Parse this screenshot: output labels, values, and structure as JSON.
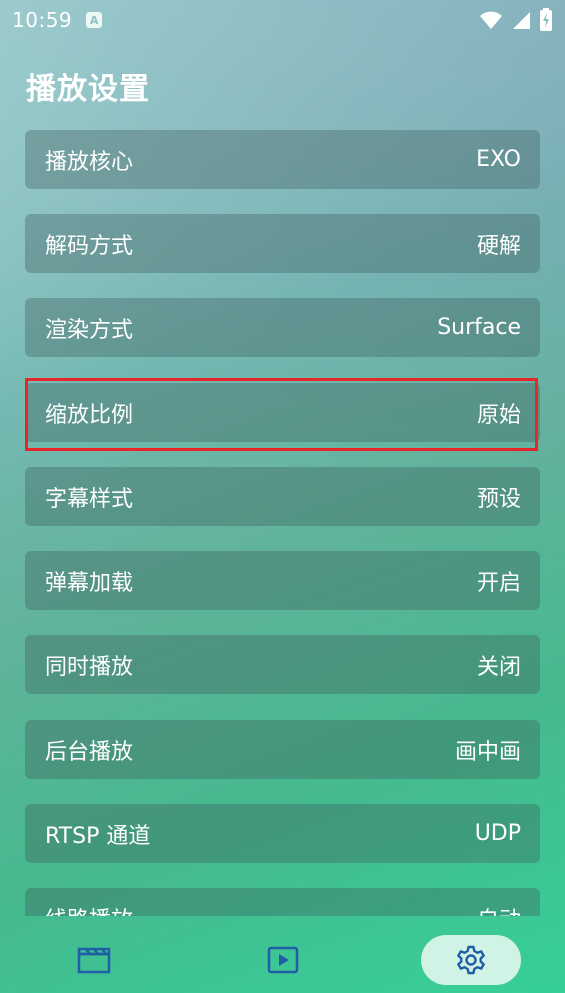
{
  "status_bar": {
    "time": "10:59",
    "notif_glyph": "A"
  },
  "page": {
    "title": "播放设置"
  },
  "settings": [
    {
      "label": "播放核心",
      "value": "EXO"
    },
    {
      "label": "解码方式",
      "value": "硬解"
    },
    {
      "label": "渲染方式",
      "value": "Surface"
    },
    {
      "label": "缩放比例",
      "value": "原始"
    },
    {
      "label": "字幕样式",
      "value": "预设"
    },
    {
      "label": "弹幕加载",
      "value": "开启"
    },
    {
      "label": "同时播放",
      "value": "关闭"
    },
    {
      "label": "后台播放",
      "value": "画中画"
    },
    {
      "label": "RTSP 通道",
      "value": "UDP"
    },
    {
      "label": "线路播放",
      "value": "自动"
    }
  ],
  "bottom_nav": [
    {
      "icon": "clapperboard-icon",
      "active": false
    },
    {
      "icon": "play-icon",
      "active": false
    },
    {
      "icon": "gear-icon",
      "active": true
    }
  ],
  "colors": {
    "highlight": "#e8262a",
    "icon": "#1f5fa8"
  }
}
